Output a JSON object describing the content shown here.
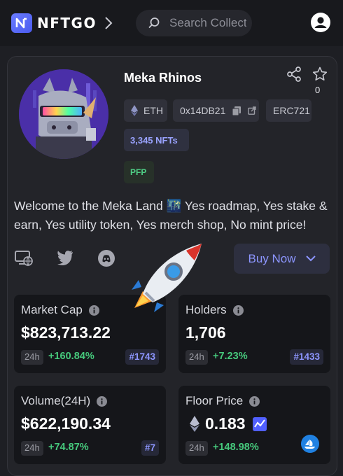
{
  "header": {
    "brand": "NFTGO",
    "search_placeholder": "Search Collections"
  },
  "collection": {
    "name": "Meka Rhinos",
    "star_count": "0",
    "chain": "ETH",
    "contract_address": "0x14DB21",
    "standard": "ERC721",
    "nft_count": "3,345 NFTs",
    "category": "PFP",
    "description": "Welcome to the Meka Land 🌃 Yes roadmap, Yes stake & earn, Yes utility token, Yes merch shop, No mint price!"
  },
  "actions": {
    "buy_label": "Buy Now"
  },
  "stats": {
    "market_cap": {
      "label": "Market Cap",
      "value": "$823,713.22",
      "period": "24h",
      "change": "+160.84%",
      "rank": "#1743"
    },
    "holders": {
      "label": "Holders",
      "value": "1,706",
      "period": "24h",
      "change": "+7.23%",
      "rank": "#1433"
    },
    "volume": {
      "label": "Volume(24H)",
      "value": "$622,190.34",
      "period": "24h",
      "change": "+74.87%",
      "rank": "#7"
    },
    "floor": {
      "label": "Floor Price",
      "value": "0.183",
      "period": "24h",
      "change": "+148.98%"
    }
  },
  "colors": {
    "accent": "#8d96ff",
    "positive": "#46c97c",
    "background": "#1e1f24",
    "card": "#232429"
  },
  "icons": [
    "logo-icon",
    "chevron-right-icon",
    "search-icon",
    "user-icon",
    "share-icon",
    "star-icon",
    "eth-icon",
    "copy-icon",
    "external-link-icon",
    "website-icon",
    "twitter-icon",
    "discord-icon",
    "chevron-down-icon",
    "info-icon",
    "chart-icon",
    "opensea-icon",
    "rocket-emoji"
  ]
}
